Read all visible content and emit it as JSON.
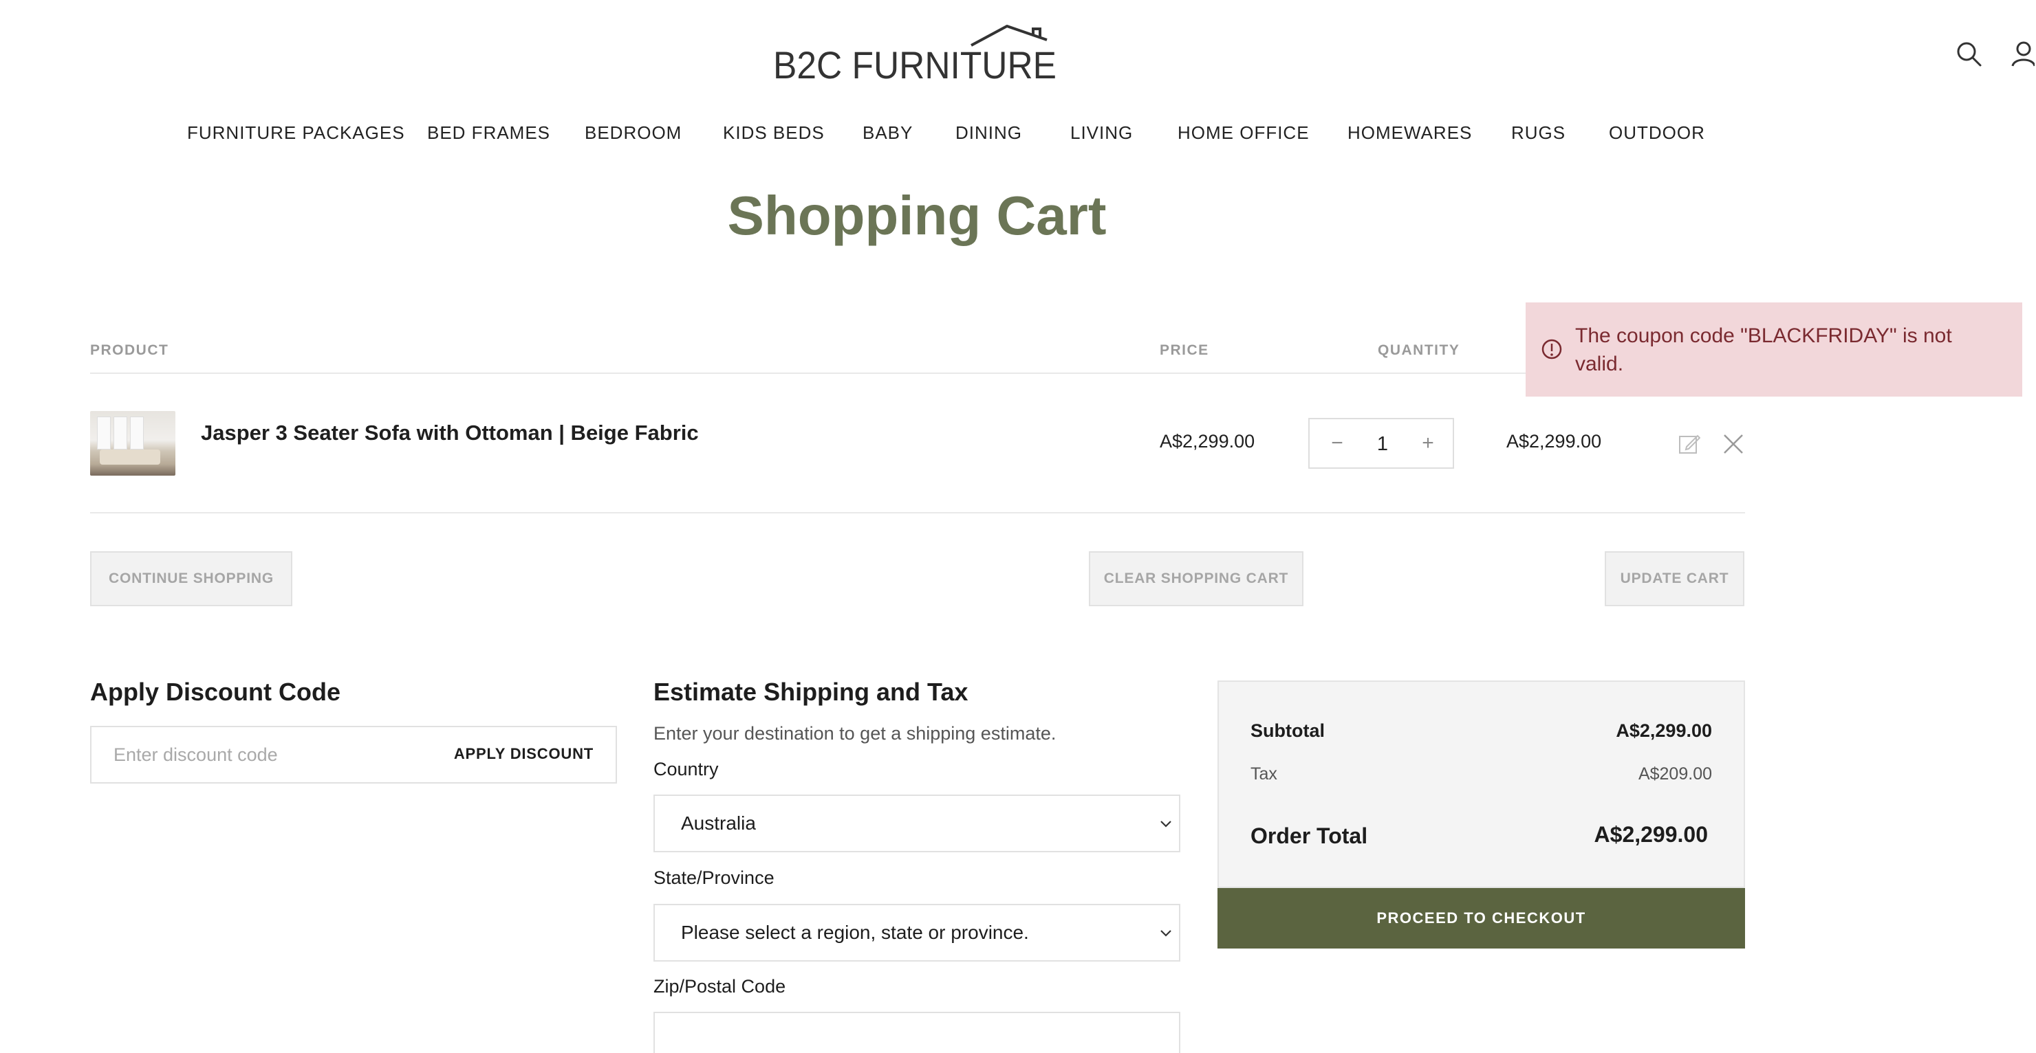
{
  "brand": {
    "logo_text": "B2C FURNITURE"
  },
  "header": {
    "icons": [
      "search-icon",
      "user-icon"
    ]
  },
  "nav": {
    "items": [
      "FURNITURE PACKAGES",
      "BED FRAMES",
      "BEDROOM",
      "KIDS BEDS",
      "BABY",
      "DINING",
      "LIVING",
      "HOME OFFICE",
      "HOMEWARES",
      "RUGS",
      "OUTDOOR"
    ]
  },
  "page": {
    "title": "Shopping Cart"
  },
  "cart": {
    "columns": {
      "product": "PRODUCT",
      "price": "PRICE",
      "quantity": "QUANTITY"
    },
    "items": [
      {
        "name": "Jasper 3 Seater Sofa with Ottoman | Beige Fabric",
        "price": "A$2,299.00",
        "quantity": "1",
        "subtotal": "A$2,299.00"
      }
    ],
    "qty_minus": "−",
    "qty_plus": "+",
    "buttons": {
      "continue": "CONTINUE SHOPPING",
      "clear": "CLEAR SHOPPING CART",
      "update": "UPDATE CART"
    }
  },
  "notice": {
    "message": "The coupon code \"BLACKFRIDAY\" is not valid.",
    "color": "#f2d7da"
  },
  "discount": {
    "title": "Apply Discount Code",
    "placeholder": "Enter discount code",
    "button": "APPLY DISCOUNT"
  },
  "shipping": {
    "title": "Estimate Shipping and Tax",
    "subtitle": "Enter your destination to get a shipping estimate.",
    "country_label": "Country",
    "country_value": "Australia",
    "state_label": "State/Province",
    "state_value": "Please select a region, state or province.",
    "zip_label": "Zip/Postal Code",
    "zip_value": ""
  },
  "summary": {
    "subtotal_label": "Subtotal",
    "subtotal_value": "A$2,299.00",
    "tax_label": "Tax",
    "tax_value": "A$209.00",
    "total_label": "Order Total",
    "total_value": "A$2,299.00",
    "checkout": "PROCEED TO CHECKOUT"
  },
  "colors": {
    "accent": "#6b7556",
    "checkout_bg": "#5b6440"
  }
}
